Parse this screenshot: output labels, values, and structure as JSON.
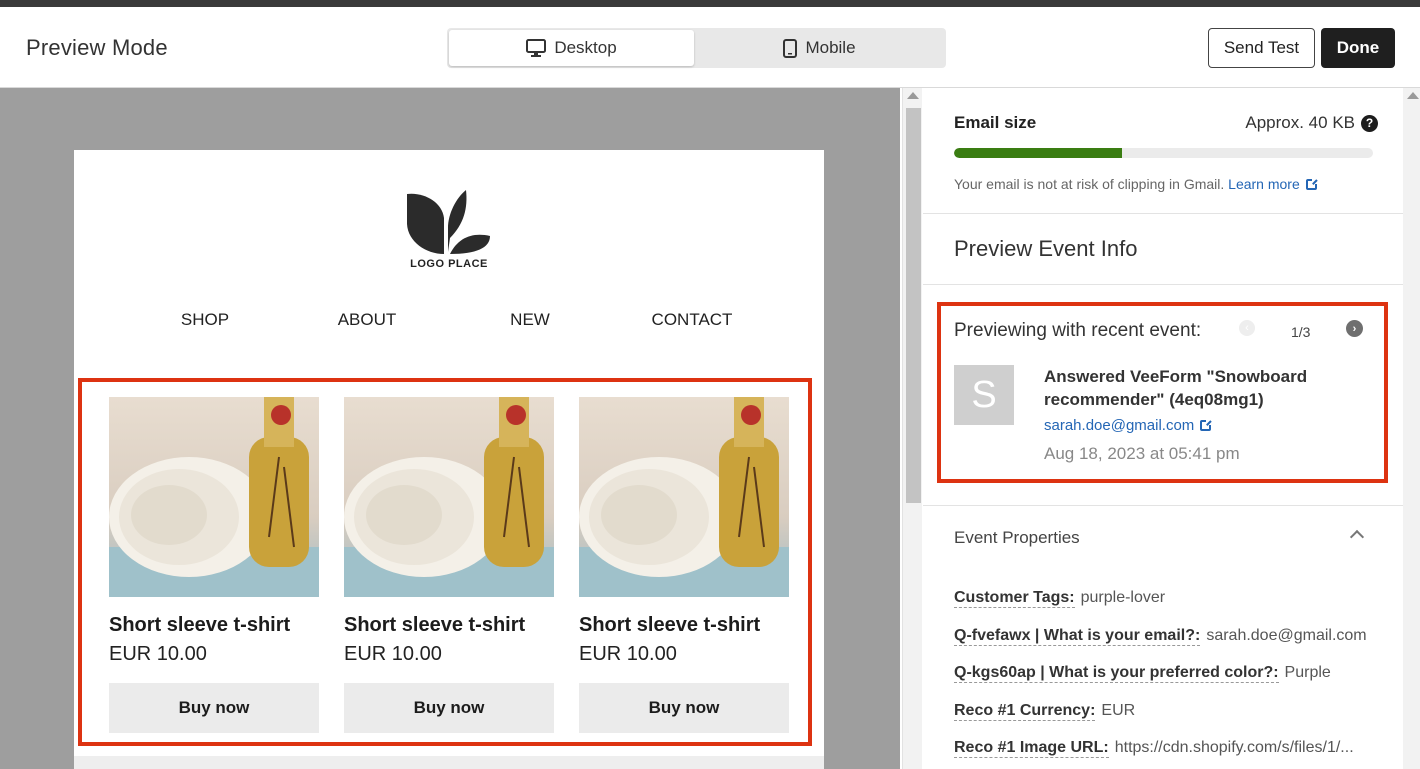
{
  "header": {
    "title": "Preview Mode",
    "view_options": [
      {
        "label": "Desktop",
        "icon": "monitor-icon",
        "active": true
      },
      {
        "label": "Mobile",
        "icon": "phone-icon",
        "active": false
      }
    ],
    "send_test_label": "Send Test",
    "done_label": "Done"
  },
  "email": {
    "logo_text": "LOGO PLACE",
    "nav": [
      "SHOP",
      "ABOUT",
      "NEW",
      "CONTACT"
    ],
    "products": [
      {
        "name": "Short sleeve t-shirt",
        "price": "EUR 10.00",
        "button": "Buy now"
      },
      {
        "name": "Short sleeve t-shirt",
        "price": "EUR 10.00",
        "button": "Buy now"
      },
      {
        "name": "Short sleeve t-shirt",
        "price": "EUR 10.00",
        "button": "Buy now"
      }
    ]
  },
  "panel": {
    "email_size_label": "Email size",
    "email_size_value": "Approx. 40 KB",
    "size_progress": 0.4,
    "clip_note": "Your email is not at risk of clipping in Gmail.",
    "learn_more": "Learn more",
    "section_title": "Preview Event Info",
    "previewing_label": "Previewing with recent event:",
    "pager": "1/3",
    "event": {
      "avatar_initial": "S",
      "title": "Answered VeeForm \"Snowboard recommender\" (4eq08mg1)",
      "email": "sarah.doe@gmail.com",
      "date": "Aug 18, 2023 at 05:41 pm"
    },
    "properties_title": "Event Properties",
    "properties": [
      {
        "key": "Customer Tags:",
        "value": "purple-lover"
      },
      {
        "key": "Q-fvefawx | What is your email?:",
        "value": "sarah.doe@gmail.com"
      },
      {
        "key": "Q-kgs60ap | What is your preferred color?:",
        "value": "Purple"
      },
      {
        "key": "Reco #1 Currency:",
        "value": "EUR"
      },
      {
        "key": "Reco #1 Image URL:",
        "value": "https://cdn.shopify.com/s/files/1/..."
      }
    ]
  },
  "colors": {
    "accent_dark": "#1f1f1f",
    "link": "#2466b5",
    "progress_fill": "#3a7d12",
    "highlight": "#dd3311"
  }
}
